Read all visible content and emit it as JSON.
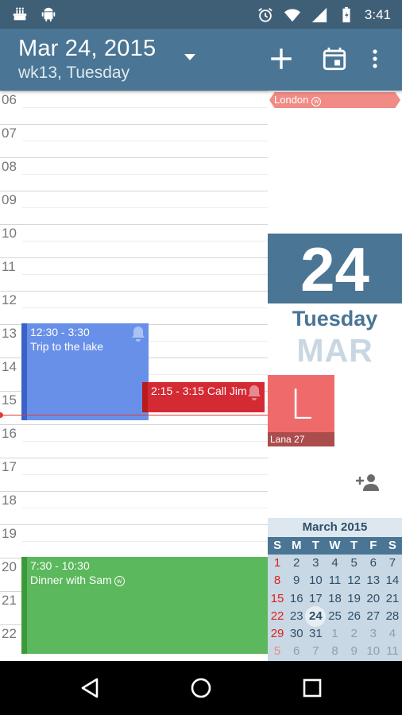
{
  "status_bar": {
    "time": "3:41",
    "icons": [
      "cake-icon",
      "android-icon",
      "alarm-icon",
      "wifi-icon",
      "signal-icon",
      "battery-charging-icon"
    ]
  },
  "app_bar": {
    "date": "Mar 24, 2015",
    "week_day": "wk13, Tuesday",
    "actions": [
      "add-icon",
      "calendar-today-icon",
      "more-vert-icon"
    ]
  },
  "timeline": {
    "hours": [
      "06",
      "07",
      "08",
      "09",
      "10",
      "11",
      "12",
      "13",
      "14",
      "15",
      "16",
      "17",
      "18",
      "19",
      "20",
      "21",
      "22"
    ],
    "events": [
      {
        "time": "12:30 - 3:30",
        "title": "Trip to the lake",
        "color": "#6890e8",
        "bar_color": "#3a62c8",
        "start_hour": 12.5,
        "end_hour": 15.5,
        "column": "left",
        "has_alarm": true
      },
      {
        "time": "2:15 - 3:15",
        "title": "Call Jim",
        "color": "#d42a33",
        "bar_color": "#b71c1c",
        "start_hour": 14.25,
        "end_hour": 15.25,
        "column": "right",
        "has_alarm": true
      },
      {
        "time": "7:30 - 10:30",
        "title": "Dinner with Sam",
        "color": "#5cb85c",
        "bar_color": "#3a9a3a",
        "start_hour": 19.5,
        "end_hour": 22.5,
        "column": "full",
        "has_alarm": false,
        "badge": "w"
      }
    ]
  },
  "right_panel": {
    "allday_event": {
      "title": "London",
      "badge": "w",
      "color": "#f08b85"
    },
    "day_number": "24",
    "day_name": "Tuesday",
    "month_abbr": "MAR",
    "contact": {
      "initial": "L",
      "label": "Lana 27",
      "color": "#ef6b6b"
    }
  },
  "mini_calendar": {
    "title": "March 2015",
    "weekdays": [
      "S",
      "M",
      "T",
      "W",
      "T",
      "F",
      "S"
    ],
    "weeks": [
      [
        "1",
        "2",
        "3",
        "4",
        "5",
        "6",
        "7"
      ],
      [
        "8",
        "9",
        "10",
        "11",
        "12",
        "13",
        "14"
      ],
      [
        "15",
        "16",
        "17",
        "18",
        "19",
        "20",
        "21"
      ],
      [
        "22",
        "23",
        "24",
        "25",
        "26",
        "27",
        "28"
      ],
      [
        "29",
        "30",
        "31",
        "1",
        "2",
        "3",
        "4"
      ],
      [
        "5",
        "6",
        "7",
        "8",
        "9",
        "10",
        "11"
      ]
    ],
    "today": "24"
  },
  "colors": {
    "primary": "#4a7594",
    "status_bar": "#3f5f76",
    "now_line": "#e53935"
  }
}
